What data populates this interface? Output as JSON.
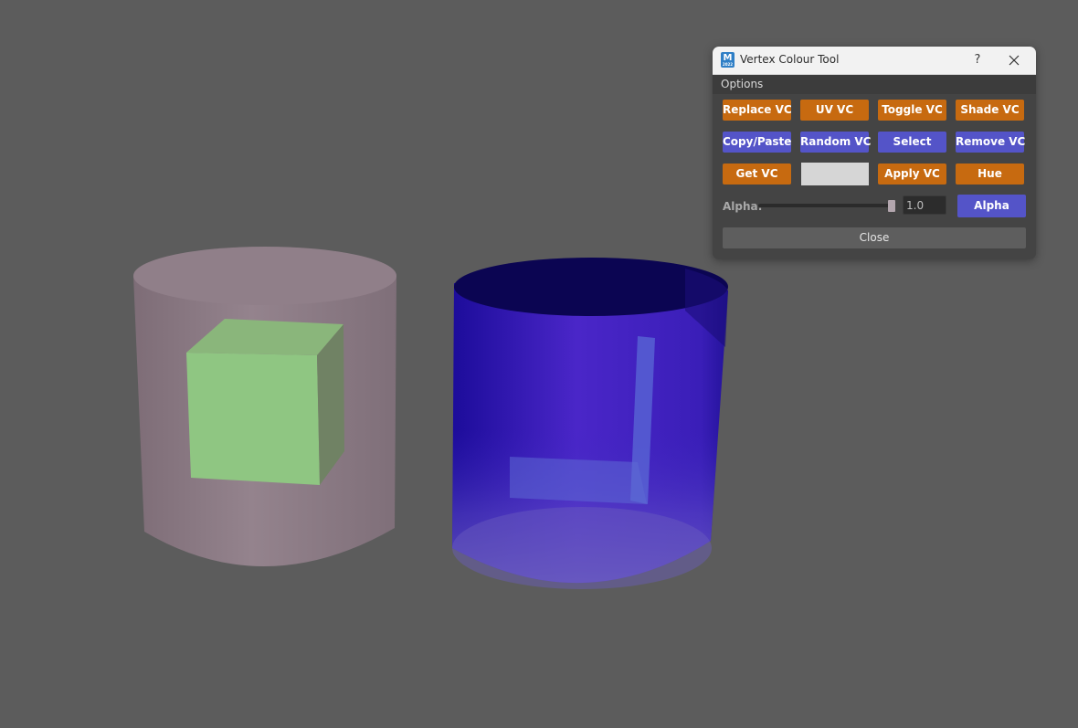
{
  "window": {
    "title": "Vertex Colour Tool",
    "app_icon_letter": "M",
    "app_icon_sub": "2022",
    "help_label": "?",
    "icons": {
      "close": "close-icon",
      "app": "maya-app-icon"
    }
  },
  "menu": {
    "options_label": "Options"
  },
  "buttons": {
    "row1": [
      "Replace VC",
      "UV VC",
      "Toggle VC",
      "Shade VC"
    ],
    "row2": [
      "Copy/Paste",
      "Random VC",
      "Select",
      "Remove VC"
    ],
    "row3_get": "Get VC",
    "row3_apply": "Apply VC",
    "row3_hue": "Hue"
  },
  "swatch": {
    "color": "#d6d6d6"
  },
  "alpha": {
    "label": "Alpha:",
    "value": "1.0",
    "slider_fraction": 1.0,
    "button_label": "Alpha"
  },
  "close_label": "Close",
  "colors": {
    "viewport_bg": "#5c5c5c",
    "orange_button": "#c76a10",
    "purple_button": "#5454c8",
    "left_cylinder": "#8a7a84",
    "cube": "#8cc07c",
    "right_cylinder": "#3a20c0"
  }
}
